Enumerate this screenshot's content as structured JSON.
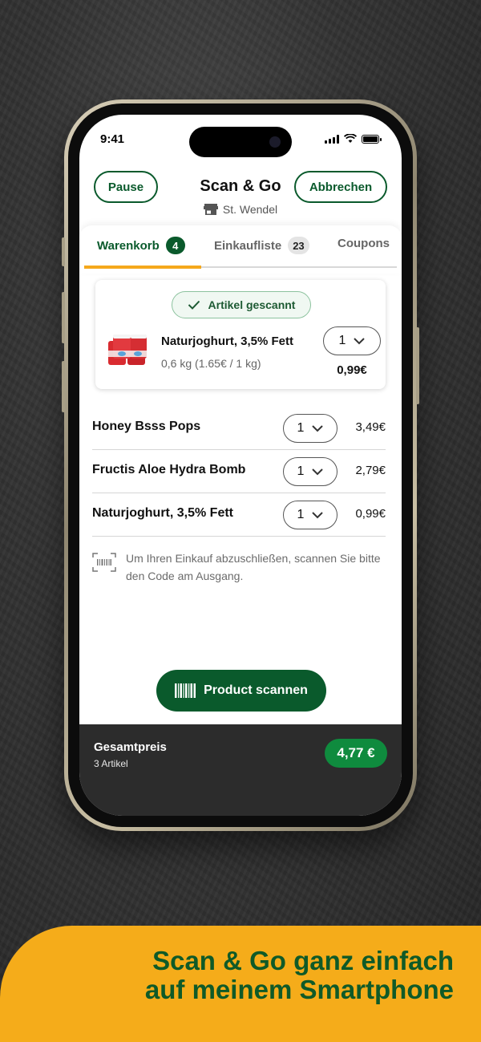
{
  "colors": {
    "brand_green": "#0a5a2c",
    "accent_orange": "#f5a81c",
    "total_green": "#0f8b3e",
    "footer_dark": "#2c2c2c"
  },
  "status_bar": {
    "time": "9:41"
  },
  "header": {
    "pause_label": "Pause",
    "title": "Scan & Go",
    "store_icon": "store-icon",
    "store_name": "St. Wendel",
    "cancel_label": "Abbrechen"
  },
  "tabs": [
    {
      "label": "Warenkorb",
      "badge": "4",
      "active": true
    },
    {
      "label": "Einkaufliste",
      "badge": "23",
      "active": false
    },
    {
      "label": "Coupons",
      "badge": "",
      "active": false
    }
  ],
  "scanned_item": {
    "status": "Artikel gescannt",
    "name": "Naturjoghurt, 3,5% Fett",
    "detail": "0,6 kg (1.65€ / 1 kg)",
    "quantity": "1",
    "price": "0,99€"
  },
  "cart_items": [
    {
      "name": "Honey Bsss Pops",
      "quantity": "1",
      "price": "3,49€"
    },
    {
      "name": "Fructis Aloe Hydra Bomb",
      "quantity": "1",
      "price": "2,79€"
    },
    {
      "name": "Naturjoghurt, 3,5% Fett",
      "quantity": "1",
      "price": "0,99€"
    }
  ],
  "hint": {
    "icon": "barcode-scan-icon",
    "text": "Um Ihren Einkauf abzuschließen, scannen Sie bitte den Code am Ausgang."
  },
  "scan_button": {
    "label": "Product scannen",
    "icon": "barcode-icon"
  },
  "footer": {
    "label": "Gesamtpreis",
    "sub": "3 Artikel",
    "total": "4,77 €"
  },
  "banner": {
    "line1": "Scan & Go ganz einfach",
    "line2": "auf meinem Smartphone"
  }
}
